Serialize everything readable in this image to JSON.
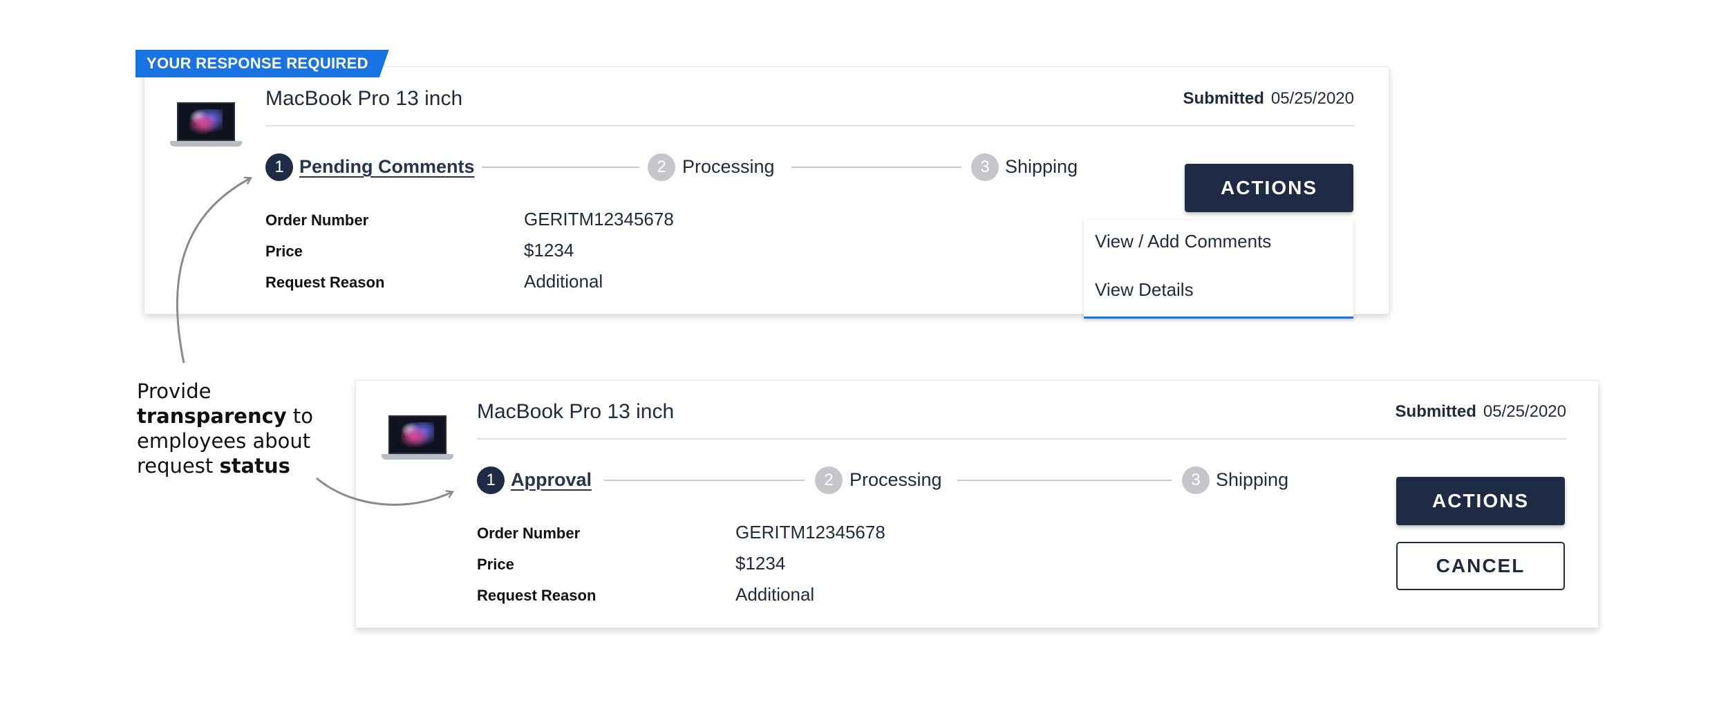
{
  "badge": "YOUR RESPONSE REQUIRED",
  "card1": {
    "title": "MacBook Pro 13 inch",
    "submitted_label": "Submitted",
    "submitted_date": "05/25/2020",
    "steps": [
      {
        "num": "1",
        "label": "Pending Comments"
      },
      {
        "num": "2",
        "label": "Processing"
      },
      {
        "num": "3",
        "label": "Shipping"
      }
    ],
    "details": [
      {
        "label": "Order Number",
        "value": "GERITM12345678"
      },
      {
        "label": "Price",
        "value": "$1234"
      },
      {
        "label": "Request Reason",
        "value": "Additional"
      }
    ],
    "actions_label": "ACTIONS",
    "menu": [
      "View / Add Comments",
      "View Details"
    ]
  },
  "card2": {
    "title": "MacBook Pro 13 inch",
    "submitted_label": "Submitted",
    "submitted_date": "05/25/2020",
    "steps": [
      {
        "num": "1",
        "label": "Approval"
      },
      {
        "num": "2",
        "label": "Processing"
      },
      {
        "num": "3",
        "label": "Shipping"
      }
    ],
    "details": [
      {
        "label": "Order Number",
        "value": "GERITM12345678"
      },
      {
        "label": "Price",
        "value": "$1234"
      },
      {
        "label": "Request Reason",
        "value": "Additional"
      }
    ],
    "actions_label": "ACTIONS",
    "cancel_label": "CANCEL"
  },
  "annotation": {
    "t1": "Provide",
    "t2": "transparency",
    "t3": "to",
    "t4": "employees about",
    "t5": "request",
    "t6": "status"
  },
  "icons": {
    "product_image": "laptop-icon",
    "arrows": [
      "curved-arrow-icon",
      "curved-arrow-icon"
    ]
  },
  "colors": {
    "navy": "#1f2a44",
    "accent_blue": "#1a73e3",
    "inactive_step": "#c4c6ca"
  }
}
